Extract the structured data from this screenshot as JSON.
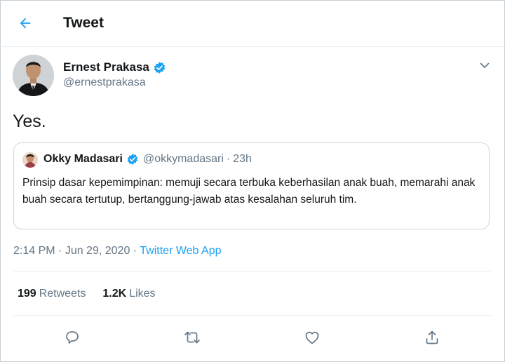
{
  "header": {
    "title": "Tweet",
    "back_icon": "arrow-left-icon"
  },
  "author": {
    "name": "Ernest Prakasa",
    "handle": "@ernestprakasa",
    "verified": true
  },
  "tweet": {
    "text": "Yes."
  },
  "quote": {
    "name": "Okky Madasari",
    "handle": "@okkymadasari",
    "separator": "·",
    "time": "23h",
    "verified": true,
    "text": "Prinsip dasar kepemimpinan: memuji secara terbuka keberhasilan anak buah, memarahi anak buah secara tertutup, bertanggung-jawab atas kesalahan seluruh tim."
  },
  "meta": {
    "time": "2:14 PM",
    "sep1": " · ",
    "date": "Jun 29, 2020",
    "sep2": " · ",
    "source": "Twitter Web App"
  },
  "stats": {
    "retweets_count": "199",
    "retweets_label": "Retweets",
    "likes_count": "1.2K",
    "likes_label": "Likes"
  },
  "colors": {
    "accent": "#1da1f2",
    "text": "#14171a",
    "muted": "#657786",
    "border": "#e6ecf0"
  },
  "actions": [
    "reply-icon",
    "retweet-icon",
    "like-icon",
    "share-icon"
  ]
}
